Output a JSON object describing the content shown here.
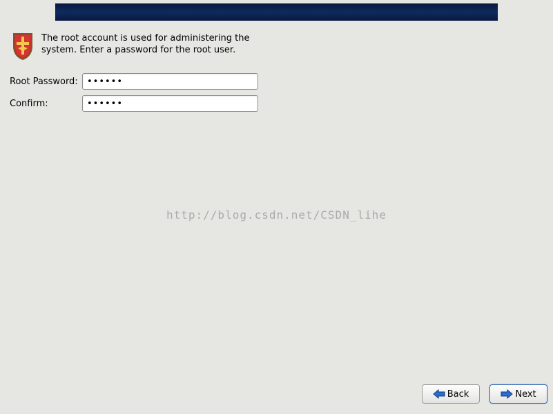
{
  "intro": "The root account is used for administering the system.  Enter a password for the root user.",
  "fields": {
    "password_label": "Root Password:",
    "password_value": "••••••",
    "confirm_label": "Confirm:",
    "confirm_value": "••••••"
  },
  "watermark": "http://blog.csdn.net/CSDN_lihe",
  "buttons": {
    "back": "Back",
    "next": "Next"
  },
  "icons": {
    "shield": "shield-icon",
    "arrow_left": "arrow-left-icon",
    "arrow_right": "arrow-right-icon"
  },
  "colors": {
    "banner": "#0f2a5c",
    "arrow_blue": "#2a6bd4",
    "arrow_outline": "#123a78"
  }
}
